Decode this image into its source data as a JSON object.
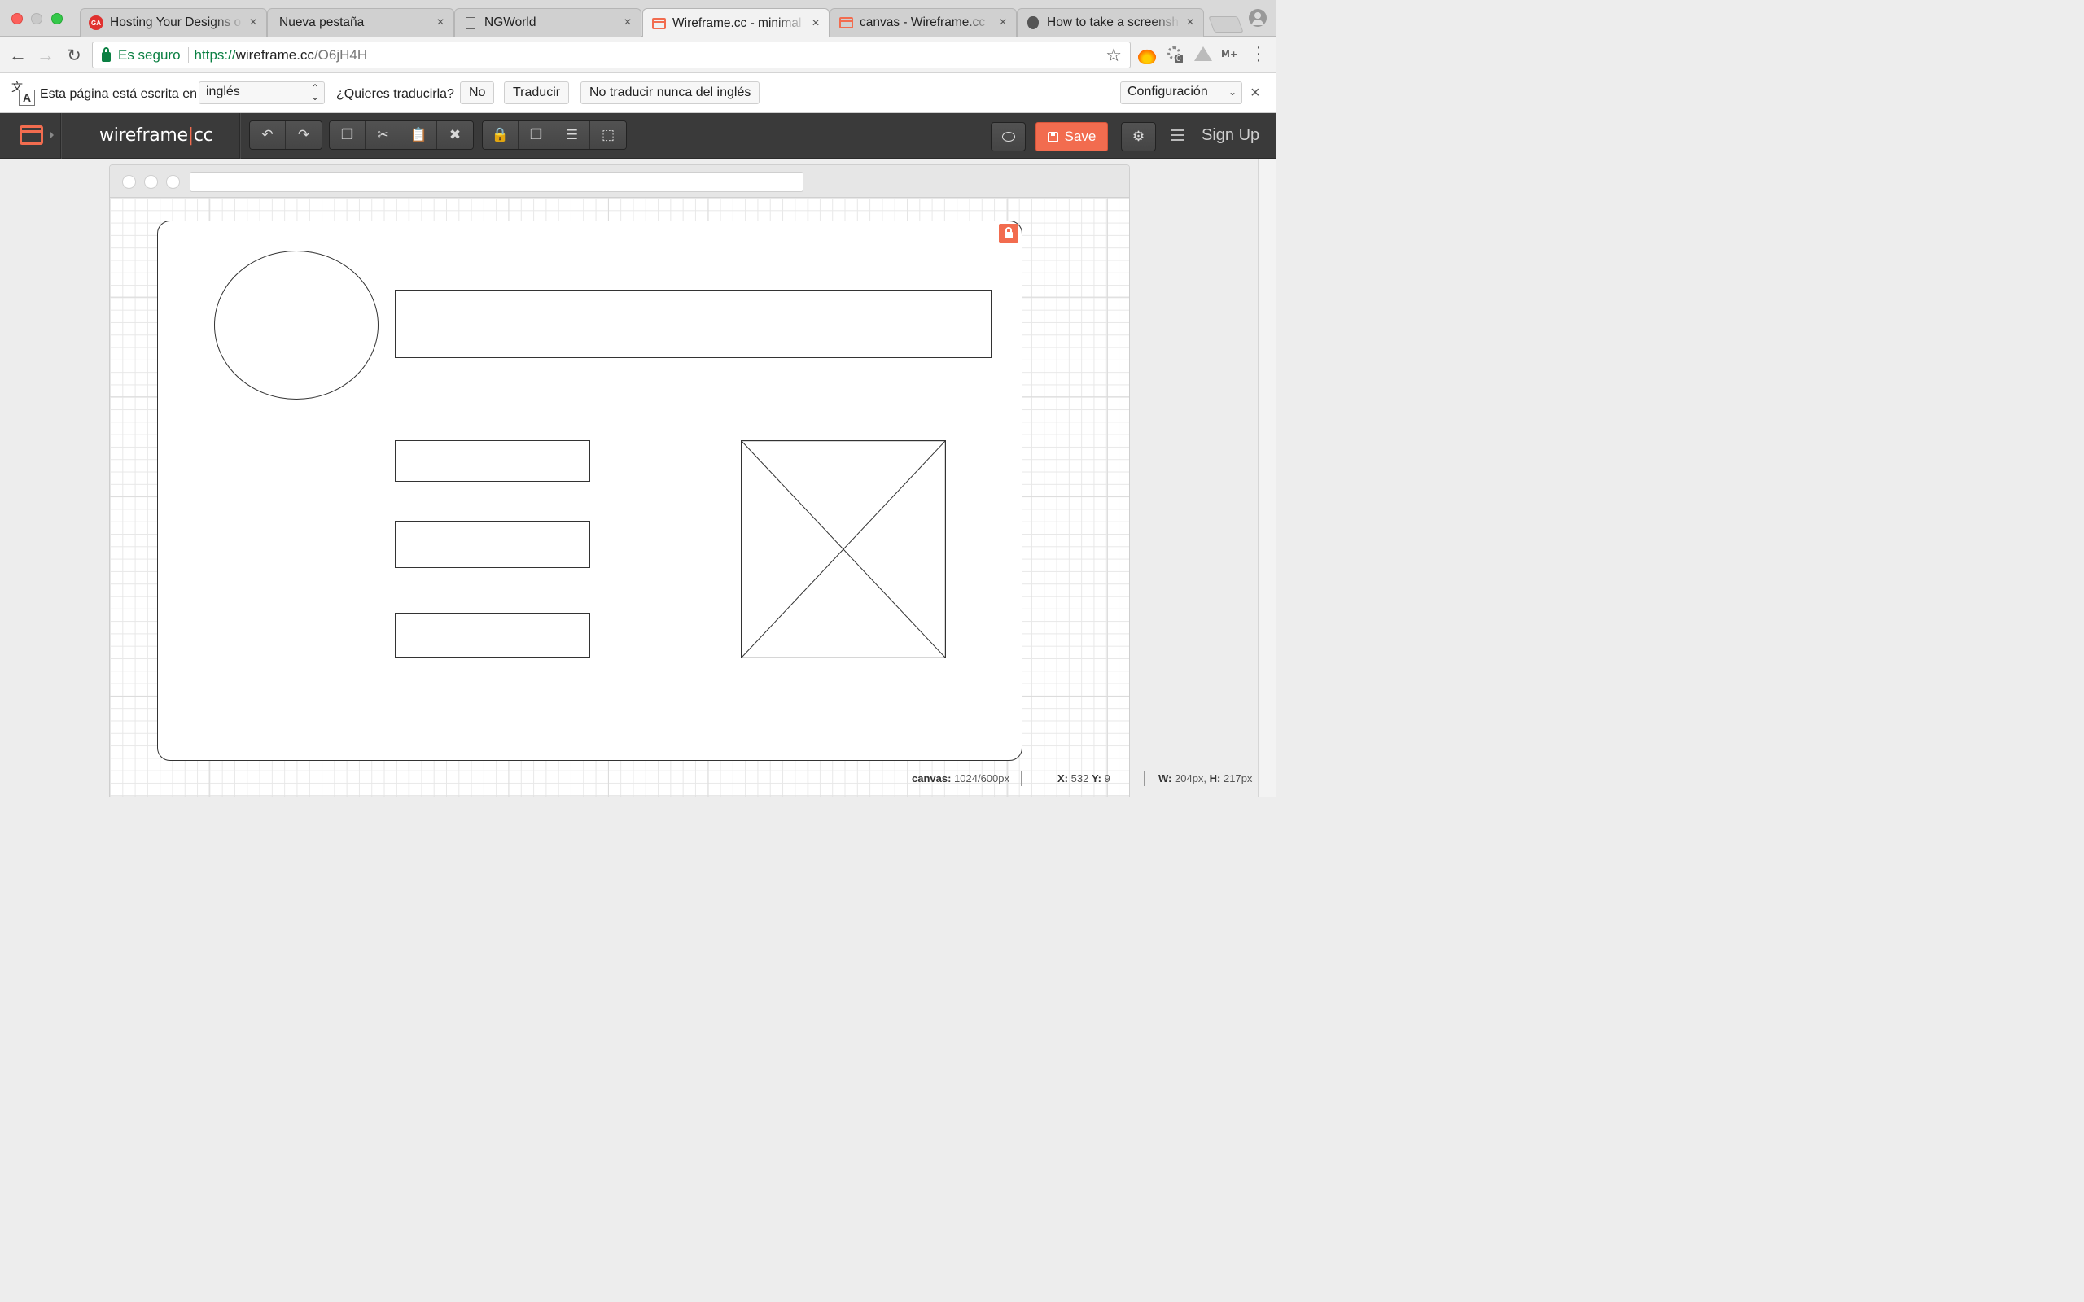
{
  "browser": {
    "tabs": [
      {
        "title": "Hosting Your Designs o",
        "icon": "ga-icon",
        "active": false
      },
      {
        "title": "Nueva pestaña",
        "icon": "",
        "active": false
      },
      {
        "title": "NGWorld",
        "icon": "document-icon",
        "active": false
      },
      {
        "title": "Wireframe.cc - minimal",
        "icon": "wireframe-icon",
        "active": true
      },
      {
        "title": "canvas - Wireframe.cc",
        "icon": "wireframe-icon",
        "active": false
      },
      {
        "title": "How to take a screensh",
        "icon": "apple-icon",
        "active": false
      }
    ],
    "tab_close": "×",
    "omnibox": {
      "security_label": "Es seguro",
      "url_scheme": "https://",
      "url_host": "wireframe.cc",
      "url_path": "/O6jH4H"
    },
    "extension_badge": "0",
    "extension_mplus": "M+"
  },
  "translate_bar": {
    "prefix": "Esta página está escrita en",
    "language": "inglés",
    "question": "¿Quieres traducirla?",
    "no_label": "No",
    "translate_label": "Traducir",
    "never_label": "No traducir nunca del inglés",
    "settings_label": "Configuración",
    "close": "×"
  },
  "app": {
    "logo_left": "wireframe",
    "logo_sep": "|",
    "logo_right": "cc",
    "save_label": "Save",
    "signup_label": "Sign Up",
    "accent": "#f26c4f",
    "toolbar_icons": {
      "history": [
        "undo-icon",
        "redo-icon"
      ],
      "clipboard": [
        "copy-icon",
        "cut-icon",
        "paste-icon",
        "delete-icon"
      ],
      "arrange": [
        "lock-icon",
        "bring-front-icon",
        "align-icon",
        "group-icon"
      ]
    }
  },
  "status": {
    "canvas_label": "canvas:",
    "canvas_value": "1024/600px",
    "x_label": "X:",
    "x_value": "532",
    "y_label": "Y:",
    "y_value": "9",
    "w_label": "W:",
    "w_value": "204px,",
    "h_label": "H:",
    "h_value": "217px"
  }
}
